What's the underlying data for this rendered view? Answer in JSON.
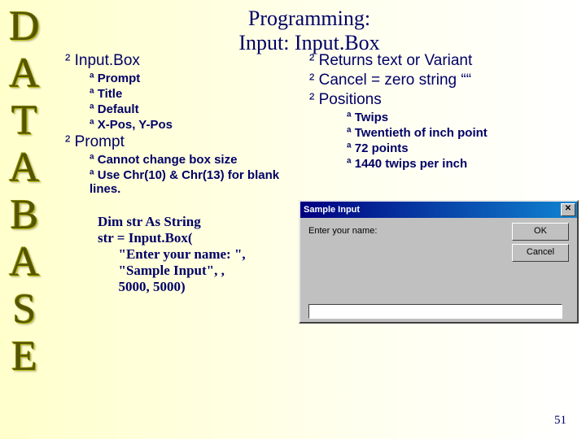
{
  "sidebar": [
    "D",
    "A",
    "T",
    "A",
    "B",
    "A",
    "S",
    "E"
  ],
  "title_line1": "Programming:",
  "title_line2": "Input:  Input.Box",
  "left": {
    "h1": "Input.Box",
    "sub1": [
      "Prompt",
      "Title",
      "Default",
      "X-Pos, Y-Pos"
    ],
    "h2": "Prompt",
    "sub2": [
      "Cannot change box size",
      "Use Chr(10) & Chr(13) for blank lines."
    ]
  },
  "right": {
    "items": [
      "Returns text or Variant",
      "Cancel = zero string ““",
      "Positions"
    ],
    "sub": [
      "Twips",
      "Twentieth of inch point",
      "72 points",
      "1440 twips per inch"
    ]
  },
  "code": "Dim str As String\nstr = Input.Box(\n      \"Enter your name: \",\n      \"Sample Input\", ,\n      5000, 5000)",
  "dialog": {
    "title": "Sample Input",
    "prompt": "Enter your name:",
    "ok": "OK",
    "cancel": "Cancel"
  },
  "marks": {
    "b1": "²",
    "b2": "ª"
  },
  "page": "51"
}
